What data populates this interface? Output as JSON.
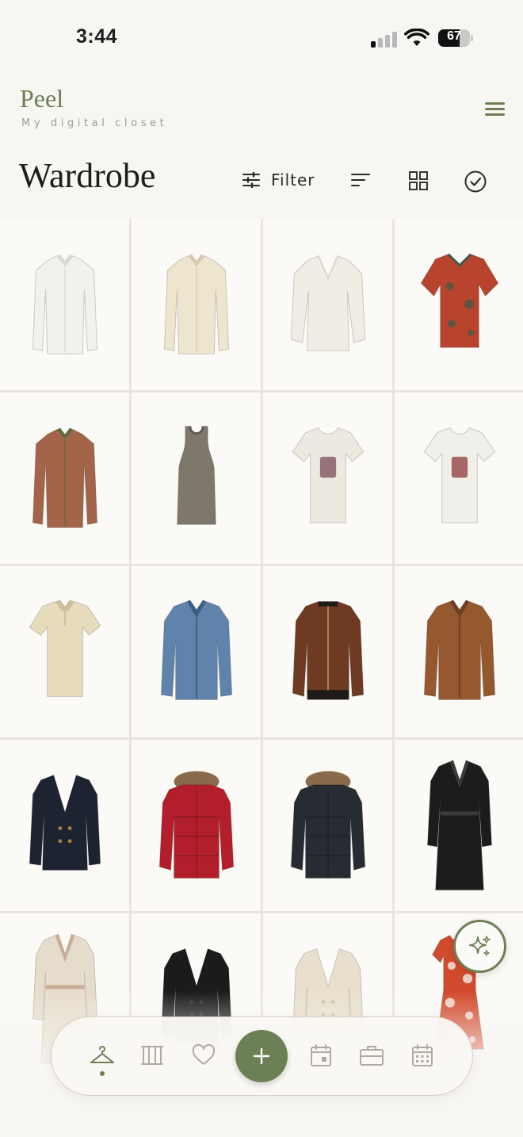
{
  "status_bar": {
    "time": "3:44",
    "battery_level": "67",
    "battery_fraction": 0.67,
    "icons": [
      "signal-icon",
      "wifi-icon",
      "battery-icon"
    ]
  },
  "header": {
    "brand_name": "Peel",
    "tagline": "My digital closet",
    "menu_icon": "hamburger-menu-icon"
  },
  "page": {
    "title": "Wardrobe"
  },
  "toolbar": {
    "filter_label": "Filter",
    "filter_icon": "sliders-icon",
    "sort_icon": "sort-icon",
    "grid_icon": "grid-view-icon",
    "select_icon": "check-circle-icon"
  },
  "wardrobe_items": [
    {
      "name": "white-button-shirt",
      "kind": "shirt",
      "color": "#f2f1ee",
      "accent": "#dcdad4"
    },
    {
      "name": "cream-button-shirt",
      "kind": "shirt",
      "color": "#eee5cf",
      "accent": "#d6cbb0"
    },
    {
      "name": "ivory-blouse",
      "kind": "blouse",
      "color": "#f1ede4",
      "accent": "#ddd6c8"
    },
    {
      "name": "red-floral-shirt",
      "kind": "shortsleeve",
      "color": "#b8442e",
      "accent": "#3f5a46"
    },
    {
      "name": "paisley-blouse",
      "kind": "shirt",
      "color": "#a4644a",
      "accent": "#5e6b3f"
    },
    {
      "name": "grey-tank-top",
      "kind": "tank",
      "color": "#7d776c",
      "accent": "#5f5a51"
    },
    {
      "name": "graphic-tee-birds",
      "kind": "tee",
      "color": "#ede9e1",
      "accent": "#7a4a56"
    },
    {
      "name": "graphic-tee-face",
      "kind": "tee",
      "color": "#f1efea",
      "accent": "#8b3b3a"
    },
    {
      "name": "beige-polo",
      "kind": "polo",
      "color": "#e6dbbd",
      "accent": "#cbbf9d"
    },
    {
      "name": "denim-jacket",
      "kind": "jacket",
      "color": "#5f83aa",
      "accent": "#3e5f82"
    },
    {
      "name": "brown-leather-bomber",
      "kind": "bomber",
      "color": "#6e3a22",
      "accent": "#1e1a18"
    },
    {
      "name": "tan-leather-jacket",
      "kind": "jacket",
      "color": "#96582e",
      "accent": "#6d3f20"
    },
    {
      "name": "navy-double-breasted-blazer",
      "kind": "blazer",
      "color": "#1d2330",
      "accent": "#a5804a"
    },
    {
      "name": "red-puffer-parka",
      "kind": "parka",
      "color": "#b21f2a",
      "accent": "#8a6a4a"
    },
    {
      "name": "black-puffer-parka",
      "kind": "parka",
      "color": "#272b33",
      "accent": "#8a6a4a"
    },
    {
      "name": "black-long-coat",
      "kind": "longcoat",
      "color": "#1c1c1c",
      "accent": "#3a3a3a"
    },
    {
      "name": "beige-trench-coat",
      "kind": "longcoat",
      "color": "#e6dccc",
      "accent": "#c9ad98"
    },
    {
      "name": "black-blazer",
      "kind": "blazer",
      "color": "#1b1b1b",
      "accent": "#2f2f2f"
    },
    {
      "name": "cream-blazer",
      "kind": "blazer",
      "color": "#e8dfcc",
      "accent": "#cfc2aa"
    },
    {
      "name": "red-paisley-dress",
      "kind": "dress",
      "color": "#d24a2e",
      "accent": "#f4e6dc"
    }
  ],
  "fab": {
    "sparkle_icon": "sparkle-icon"
  },
  "bottom_nav": {
    "items": [
      {
        "name": "nav-wardrobe",
        "icon": "hanger-icon",
        "active": true
      },
      {
        "name": "nav-closet",
        "icon": "rack-icon",
        "active": false
      },
      {
        "name": "nav-favorites",
        "icon": "heart-icon",
        "active": false
      },
      {
        "name": "nav-add",
        "icon": "plus-icon",
        "active": false
      },
      {
        "name": "nav-planner",
        "icon": "calendar-day-icon",
        "active": false
      },
      {
        "name": "nav-trips",
        "icon": "suitcase-icon",
        "active": false
      },
      {
        "name": "nav-calendar",
        "icon": "calendar-grid-icon",
        "active": false
      }
    ],
    "active_color": "#6d7f55",
    "inactive_color": "#b2aaa0"
  },
  "colors": {
    "brand": "#6d7f55",
    "background": "#f8f6f2",
    "grid_divider": "#ebe4dc"
  }
}
